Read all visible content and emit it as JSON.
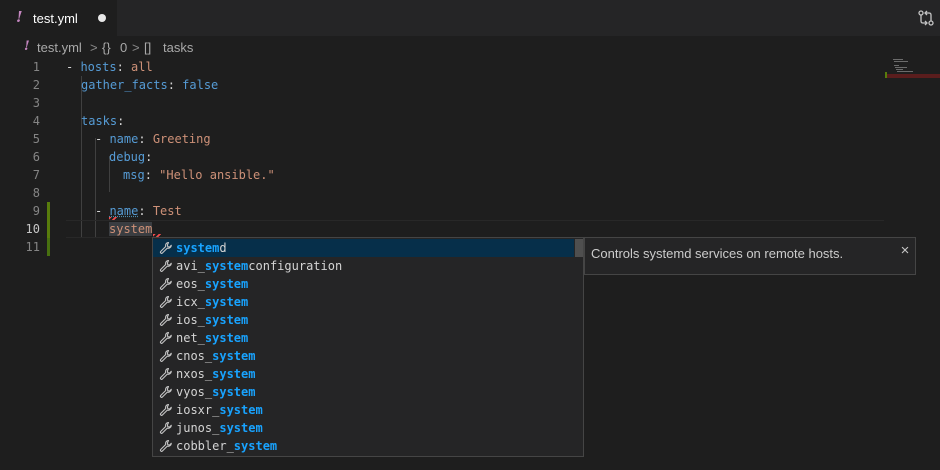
{
  "tab": {
    "bang": "!",
    "filename": "test.yml"
  },
  "breadcrumb": {
    "file": "test.yml",
    "sep1": ">",
    "obj_symbol": "{}",
    "obj_index": "0",
    "sep2": ">",
    "arr_symbol": "[]",
    "arr_name": "tasks"
  },
  "lines": [
    {
      "num": "1",
      "dash": "- ",
      "key": "hosts",
      "colon": ": ",
      "value": "all",
      "value_kind": "str"
    },
    {
      "num": "2",
      "key": "gather_facts",
      "colon": ": ",
      "value": "false",
      "value_kind": "bool"
    },
    {
      "num": "3"
    },
    {
      "num": "4",
      "key": "tasks",
      "colon": ":"
    },
    {
      "num": "5",
      "dash": "- ",
      "key": "name",
      "colon": ": ",
      "value": "Greeting",
      "value_kind": "str"
    },
    {
      "num": "6",
      "key": "debug",
      "colon": ":"
    },
    {
      "num": "7",
      "key": "msg",
      "colon": ": ",
      "value": "\"Hello ansible.\"",
      "value_kind": "str"
    },
    {
      "num": "8"
    },
    {
      "num": "9",
      "dash": "- ",
      "key": "name",
      "colon": ": ",
      "value": "Test",
      "value_kind": "str"
    },
    {
      "num": "10",
      "key": "system"
    },
    {
      "num": "11"
    }
  ],
  "suggest": {
    "items": [
      {
        "pre": "",
        "match": "system",
        "post": "d",
        "selected": true
      },
      {
        "pre": "avi_",
        "match": "system",
        "post": "configuration"
      },
      {
        "pre": "eos_",
        "match": "system",
        "post": ""
      },
      {
        "pre": "icx_",
        "match": "system",
        "post": ""
      },
      {
        "pre": "ios_",
        "match": "system",
        "post": ""
      },
      {
        "pre": "net_",
        "match": "system",
        "post": ""
      },
      {
        "pre": "cnos_",
        "match": "system",
        "post": ""
      },
      {
        "pre": "nxos_",
        "match": "system",
        "post": ""
      },
      {
        "pre": "vyos_",
        "match": "system",
        "post": ""
      },
      {
        "pre": "iosxr_",
        "match": "system",
        "post": ""
      },
      {
        "pre": "junos_",
        "match": "system",
        "post": ""
      },
      {
        "pre": "cobbler_",
        "match": "system",
        "post": ""
      }
    ],
    "item_icon": "wrench-icon",
    "details": "Controls systemd services on remote hosts.",
    "close": "×"
  },
  "colors": {
    "key": "#569cd6",
    "string": "#ce9178",
    "match_highlight": "#18a3ff",
    "selected_row": "#062f4a",
    "modified_gutter": "#587c0c"
  }
}
